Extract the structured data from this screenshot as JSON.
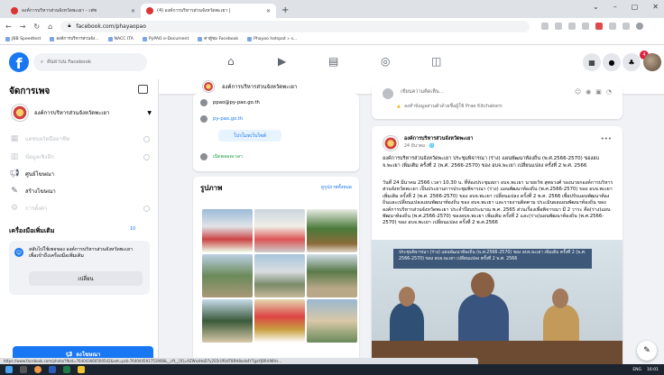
{
  "browser": {
    "tabs": [
      {
        "title": "องค์การบริหารส่วนจังหวัดพะเยา - เฟซ",
        "active": false
      },
      {
        "title": "(4) องค์การบริหารส่วนจังหวัดพะเยา |",
        "active": true
      }
    ],
    "new_tab": "+",
    "url": "facebook.com/phayaopao",
    "bookmarks": [
      "JBB Speedtest",
      "องค์การบริหารส่วนจัง...",
      "NACC ITA",
      "PyPAO e-Document",
      "ค่าตู้ชม Facebook",
      "Phayao hotspot » s..."
    ]
  },
  "fb": {
    "logo": "f",
    "search_placeholder": "ค้นหาบน Facebook",
    "notification_count": "4"
  },
  "sidebar": {
    "title": "จัดการเพจ",
    "page_name": "องค์การบริหารส่วนจังหวัดพะเยา",
    "items": [
      {
        "label": "แดชบอร์ดมืออาชีพ",
        "dim": true
      },
      {
        "label": "ข้อมูลเชิงลึก",
        "dim": true
      },
      {
        "label": "ศูนย์โฆษณา",
        "dim": false
      },
      {
        "label": "สร้างโฆษณา",
        "dim": false
      },
      {
        "label": "การตั้งค่า",
        "dim": true
      }
    ],
    "tools_title": "เครื่องมือเพิ่มเติม",
    "tools_badge": "10",
    "promo_text": "สลับไปใช้เพจของ องค์การบริหารส่วนจังหวัดพะเยา เพื่อเข้าถึงเครื่องมือเพิ่มเติม",
    "switch_label": "เปลี่ยน",
    "create_ad_label": "ลงโฆษณา"
  },
  "page_header": {
    "name": "องค์การบริหารส่วนจังหวัดพะเยา",
    "more": "—"
  },
  "intro": {
    "email": "ppao@py-pao.go.th",
    "website": "py-pao.go.th",
    "promote_label": "โปรโมทเว็บไซต์",
    "status": "เปิดตลอดเวลา"
  },
  "photos": {
    "title": "รูปภาพ",
    "link": "ดูรูปภาพทั้งหมด"
  },
  "composer": {
    "placeholder": "เขียนความคิดเห็น...",
    "warning": "ลงทำข้อมูลส่วนตัวด้วยชื่อผู้ใช้ Prae Kitchakorn"
  },
  "post": {
    "author": "องค์การบริหารส่วนจังหวัดพะเยา",
    "date": "24 มีนาคม · 🌐",
    "headline": "องค์การบริหารส่วนจังหวัดพะเยา ประชุมพิจารณา (ร่าง) แผนพัฒนาท้องถิ่น (พ.ศ.2566-2570) ของอบจ.พะเยา เพิ่มเติม ครั้งที่ 2 (พ.ศ. 2566-2570) ของ อบจ.พะเยา เปลี่ยนแปลง ครั้งที่ 2 พ.ศ. 2566",
    "body": "วันที่ 24 มีนาคม 2566 เวลา 10.30 น. ที่ห้องประชุมสภา อบจ.พะเยา นายธวัช สุทธวงศ์ รองนายกองค์การบริหารส่วนจังหวัดพะเยา เป็นประธานการประชุมพิจารณา (ร่าง) แผนพัฒนาท้องถิ่น (พ.ศ.2566-2570) ของ อบจ.พะเยา เพิ่มเติม ครั้งที่ 2 (พ.ศ. 2566-2570) ของ อบจ.พะเยา เปลี่ยนแปลง ครั้งที่ 2 พ.ศ. 2566 เพื่อปรับแผนพัฒนาท้องถิ่นและเปลี่ยนแปลงแผนพัฒนาท้องถิ่น ของ อบจ.พะเยา และรายงานติดตาม ประเมินผลแผนพัฒนาท้องถิ่น ขององค์การบริหารส่วนจังหวัดพะเยา ประจำปีงบประมาณ พ.ศ. 2565 ส่วนเรื่องเพื่อพิจารณา มี 2 วาระ คือ(ร่าง)แผนพัฒนาท้องถิ่น (พ.ศ.2566-2570) ของอบจ.พะเยา เพิ่มเติม ครั้งที่ 2 และ(ร่าง)แผนพัฒนาท้องถิ่น (พ.ศ.2566-2570) ของ อบจ.พะเยา เปลี่ยนแปลง ครั้งที่ 2 พ.ศ.2566",
    "image_banner": "ประชุมพิจารณา (ร่าง) แผนพัฒนาท้องถิ่น (พ.ศ.2566-2570) ของ อบจ.พะเยา เพิ่มเติม ครั้งที่ 2 (พ.ศ. 2566-2570) ของ อบจ.พะเยา เปลี่ยนแปลง ครั้งที่ 2 พ.ศ. 2566"
  },
  "status_url": "https://www.facebook.com/photo/?fbid=764043660500542&set=pcb.764044591751908&__cft__[0]=AZWxzHoD7y2S5rUfUdT8RH8ozb4Y7gaYJBRrI98Vs...",
  "taskbar": {
    "lang": "ENG",
    "time": "16:01"
  },
  "colors": {
    "brand": "#1877f2",
    "badge": "#e41e3f"
  }
}
